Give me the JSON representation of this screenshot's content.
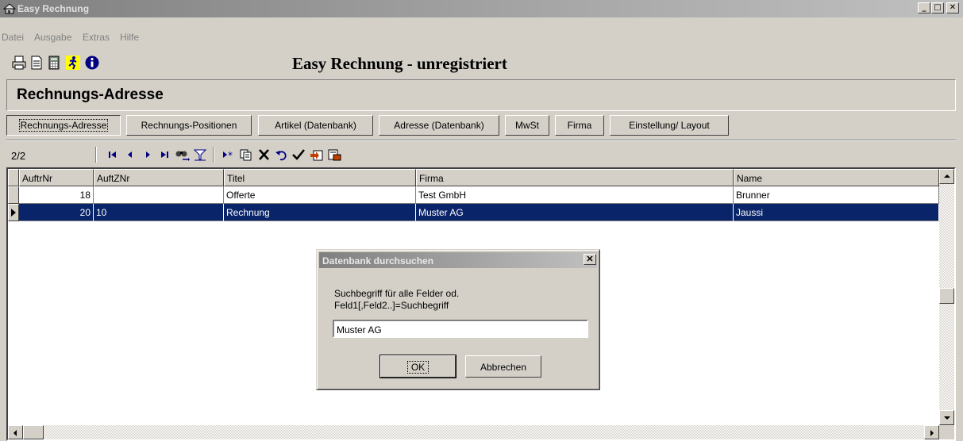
{
  "window": {
    "title": "Easy Rechnung"
  },
  "menu": [
    "Datei",
    "Ausgabe",
    "Extras",
    "Hilfe"
  ],
  "toolbar": {
    "heading": "Easy Rechnung - unregistriert",
    "icons": [
      "printer-icon",
      "document-icon",
      "calculator-icon",
      "runner-icon",
      "info-icon"
    ]
  },
  "section": {
    "label": "Rechnungs-Adresse"
  },
  "tabs": [
    {
      "label": "Rechnungs-Adresse",
      "active": true
    },
    {
      "label": "Rechnungs-Positionen",
      "active": false
    },
    {
      "label": "Artikel (Datenbank)",
      "active": false
    },
    {
      "label": "Adresse (Datenbank)",
      "active": false
    },
    {
      "label": "MwSt",
      "active": false
    },
    {
      "label": "Firma",
      "active": false
    },
    {
      "label": "Einstellung/ Layout",
      "active": false
    }
  ],
  "navigator": {
    "record_counter": "2/2"
  },
  "grid": {
    "columns": [
      "AuftrNr",
      "AuftZNr",
      "Titel",
      "Firma",
      "Name"
    ],
    "rows": [
      {
        "AuftrNr": "18",
        "AuftZNr": "",
        "Titel": "Offerte",
        "Firma": "Test GmbH",
        "Name": "Brunner",
        "selected": false
      },
      {
        "AuftrNr": "20",
        "AuftZNr": "10",
        "Titel": "Rechnung",
        "Firma": "Muster AG",
        "Name": "Jaussi",
        "selected": true
      }
    ]
  },
  "dialog": {
    "title": "Datenbank durchsuchen",
    "message_line1": "Suchbegriff für alle Felder od.",
    "message_line2": "Feld1[,Feld2..]=Suchbegriff",
    "input_value": "Muster AG",
    "ok_label": "OK",
    "cancel_label": "Abbrechen",
    "close_glyph": "✕"
  },
  "colors": {
    "selection": "#0a246a",
    "face": "#d4d0c8"
  }
}
